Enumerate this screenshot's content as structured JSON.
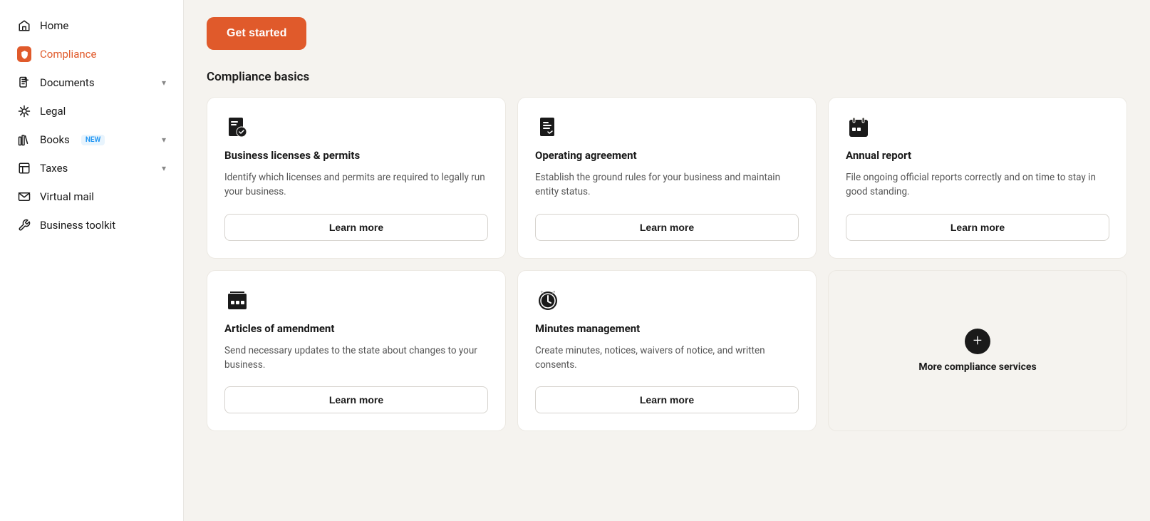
{
  "sidebar": {
    "items": [
      {
        "id": "home",
        "label": "Home",
        "icon": "home-icon",
        "active": false
      },
      {
        "id": "compliance",
        "label": "Compliance",
        "icon": "shield-icon",
        "active": true
      },
      {
        "id": "documents",
        "label": "Documents",
        "icon": "document-icon",
        "active": false,
        "hasChevron": true
      },
      {
        "id": "legal",
        "label": "Legal",
        "icon": "legal-icon",
        "active": false
      },
      {
        "id": "books",
        "label": "Books",
        "icon": "books-icon",
        "active": false,
        "badge": "NEW",
        "hasChevron": true
      },
      {
        "id": "taxes",
        "label": "Taxes",
        "icon": "taxes-icon",
        "active": false,
        "hasChevron": true
      },
      {
        "id": "virtual-mail",
        "label": "Virtual mail",
        "icon": "mail-icon",
        "active": false
      },
      {
        "id": "business-toolkit",
        "label": "Business toolkit",
        "icon": "toolkit-icon",
        "active": false
      }
    ]
  },
  "main": {
    "get_started_label": "Get started",
    "section_title": "Compliance basics",
    "cards": [
      {
        "id": "licenses",
        "icon": "license-icon",
        "title": "Business licenses & permits",
        "desc": "Identify which licenses and permits are required to legally run your business.",
        "btn_label": "Learn more"
      },
      {
        "id": "operating-agreement",
        "icon": "agreement-icon",
        "title": "Operating agreement",
        "desc": "Establish the ground rules for your business and maintain entity status.",
        "btn_label": "Learn more"
      },
      {
        "id": "annual-report",
        "icon": "calendar-icon",
        "title": "Annual report",
        "desc": "File ongoing official reports correctly and on time to stay in good standing.",
        "btn_label": "Learn more"
      },
      {
        "id": "articles-amendment",
        "icon": "amendment-icon",
        "title": "Articles of amendment",
        "desc": "Send necessary updates to the state about changes to your business.",
        "btn_label": "Learn more"
      },
      {
        "id": "minutes-management",
        "icon": "minutes-icon",
        "title": "Minutes management",
        "desc": "Create minutes, notices, waivers of notice, and written consents.",
        "btn_label": "Learn more"
      },
      {
        "id": "more-services",
        "label": "More compliance services"
      }
    ]
  },
  "colors": {
    "accent": "#e05a2b",
    "active_nav": "#e05a2b"
  }
}
